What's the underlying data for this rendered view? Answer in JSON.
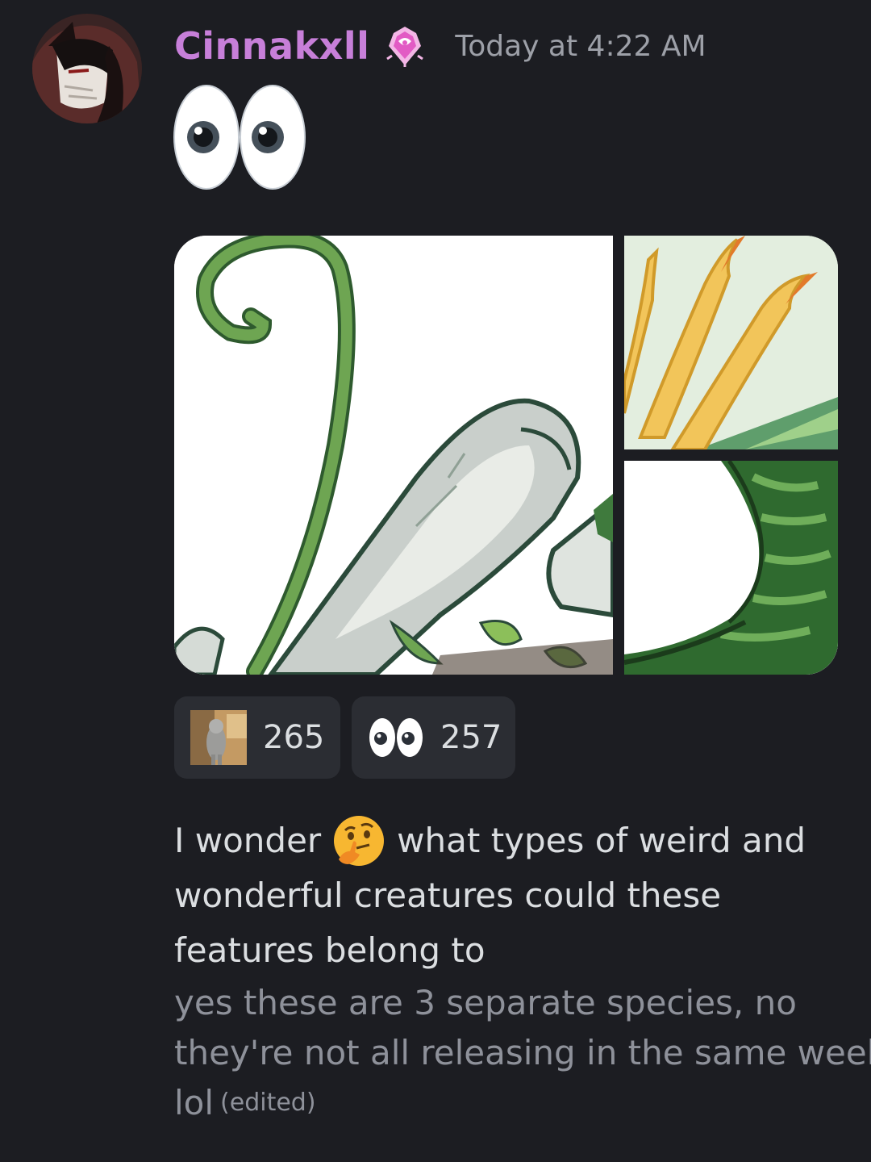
{
  "message": {
    "author": "Cinnakxll",
    "timestamp": "Today at 4:22 AM",
    "big_emoji": "eyes-emoji",
    "role_icon": "pink-gem-badge-icon",
    "attachments": [
      {
        "name": "vine-wing-image"
      },
      {
        "name": "yellow-claws-image"
      },
      {
        "name": "green-scales-image"
      }
    ],
    "reactions": [
      {
        "icon": "cat-sticker-thumbnail",
        "count": "265"
      },
      {
        "icon": "eyes-emoji",
        "count": "257"
      }
    ],
    "body": {
      "line1_before": "I wonder",
      "line1_emoji": "thinking-face-emoji",
      "line1_after": "what types of weird and",
      "line2": "wonderful creatures could these",
      "line3": "features belong to",
      "sub_line1": "yes these are 3 separate species, no",
      "sub_line2": "they're not all releasing in the same week",
      "sub_line3": "lol",
      "edited": "(edited)"
    }
  },
  "colors": {
    "background": "#1c1d22",
    "username": "#c77fd9",
    "timestamp": "#9da0a8",
    "reaction_bg": "#2b2d33",
    "muted_text": "#8e919a"
  }
}
